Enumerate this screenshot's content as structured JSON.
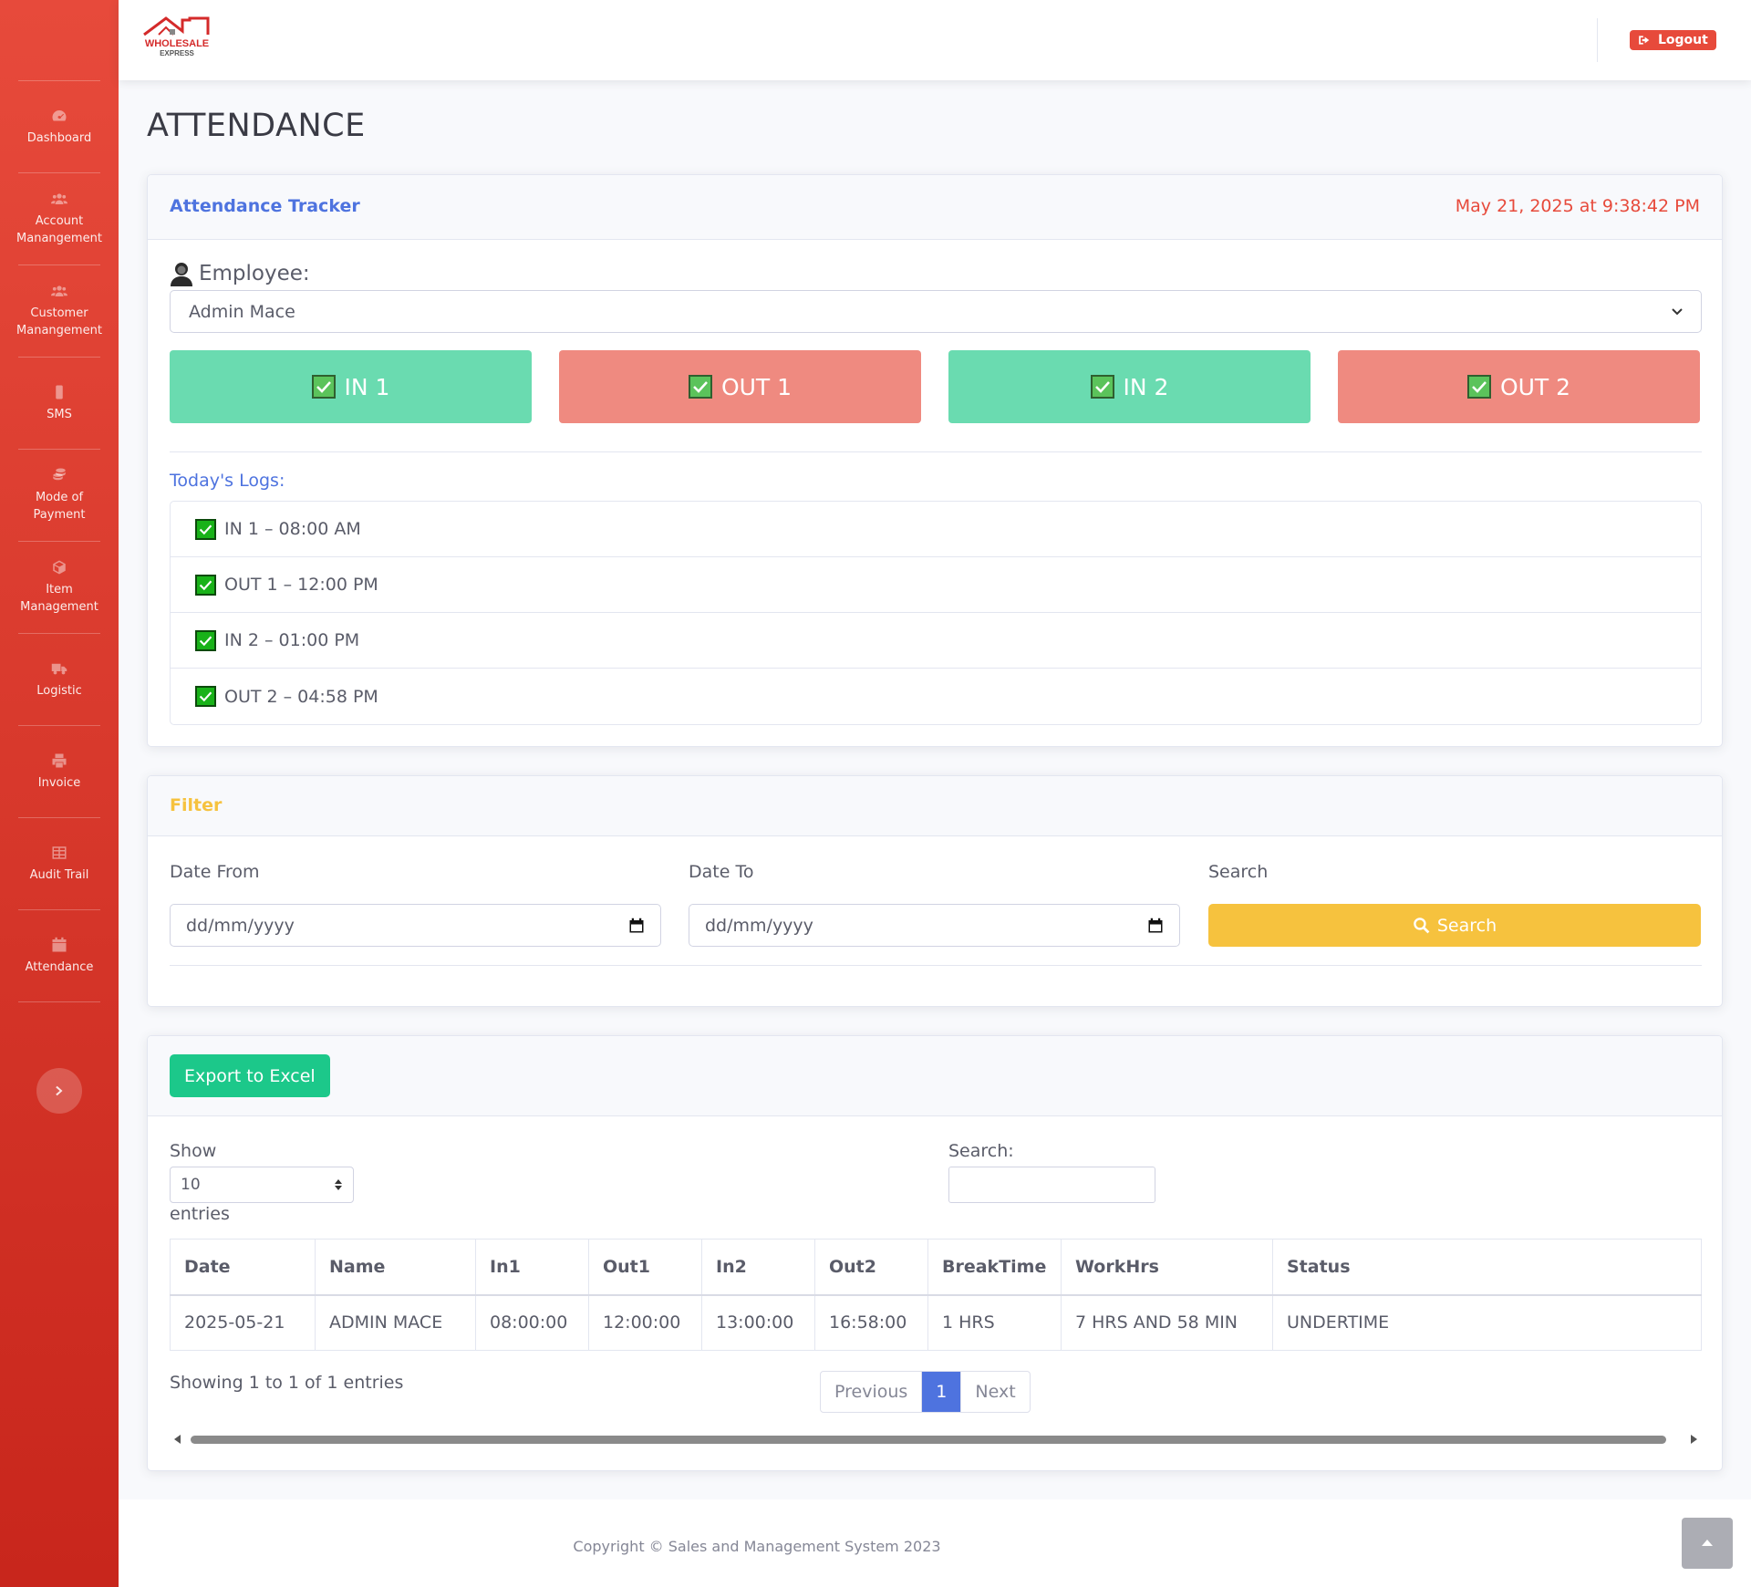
{
  "brand": {
    "logo_text": "WHOLESALE",
    "logo_subtext": "EXPRESS"
  },
  "sidebar": {
    "items": [
      {
        "label": "Dashboard",
        "icon": "tachometer-icon"
      },
      {
        "label": "Account\nManangement",
        "icon": "users-icon"
      },
      {
        "label": "Customer\nManangement",
        "icon": "users-icon"
      },
      {
        "label": "SMS",
        "icon": "mobile-icon"
      },
      {
        "label": "Mode of\nPayment",
        "icon": "coins-icon"
      },
      {
        "label": "Item\nManagement",
        "icon": "box-icon"
      },
      {
        "label": "Logistic",
        "icon": "truck-icon"
      },
      {
        "label": "Invoice",
        "icon": "print-icon"
      },
      {
        "label": "Audit Trail",
        "icon": "table-icon"
      },
      {
        "label": "Attendance",
        "icon": "calendar-icon"
      }
    ]
  },
  "topbar": {
    "logout_label": "Logout"
  },
  "page": {
    "title": "ATTENDANCE"
  },
  "tracker": {
    "title": "Attendance Tracker",
    "datetime": "May 21, 2025 at 9:38:42 PM",
    "employee_label": "Employee:",
    "employee_value": "Admin Mace",
    "buttons": [
      {
        "label": "IN 1",
        "kind": "in"
      },
      {
        "label": "OUT 1",
        "kind": "out"
      },
      {
        "label": "IN 2",
        "kind": "in"
      },
      {
        "label": "OUT 2",
        "kind": "out"
      }
    ],
    "logs_label": "Today's Logs:",
    "logs": [
      "IN 1 – 08:00 AM",
      "OUT 1 – 12:00 PM",
      "IN 2 – 01:00 PM",
      "OUT 2 – 04:58 PM"
    ]
  },
  "filter": {
    "title": "Filter",
    "date_from_label": "Date From",
    "date_to_label": "Date To",
    "search_label": "Search",
    "date_placeholder": "dd/mm/yyyy",
    "search_button": "Search"
  },
  "table": {
    "export_label": "Export to Excel",
    "show_label": "Show",
    "entries_value": "10",
    "entries_label": "entries",
    "search_label": "Search:",
    "columns": [
      "Date",
      "Name",
      "In1",
      "Out1",
      "In2",
      "Out2",
      "BreakTime",
      "WorkHrs",
      "Status"
    ],
    "rows": [
      [
        "2025-05-21",
        "ADMIN MACE",
        "08:00:00",
        "12:00:00",
        "13:00:00",
        "16:58:00",
        "1 HRS",
        "7 HRS AND 58 MIN",
        "UNDERTIME"
      ]
    ],
    "info": "Showing 1 to 1 of 1 entries",
    "pager": {
      "previous": "Previous",
      "current": "1",
      "next": "Next"
    }
  },
  "footer": {
    "copyright": "Copyright © Sales and Management System 2023"
  },
  "colors": {
    "primary": "#4e73df",
    "danger": "#e74a3b",
    "warning": "#f6c23e",
    "success": "#1cc88a",
    "in_button": "#6adbb0",
    "out_button": "#ef8a80"
  }
}
